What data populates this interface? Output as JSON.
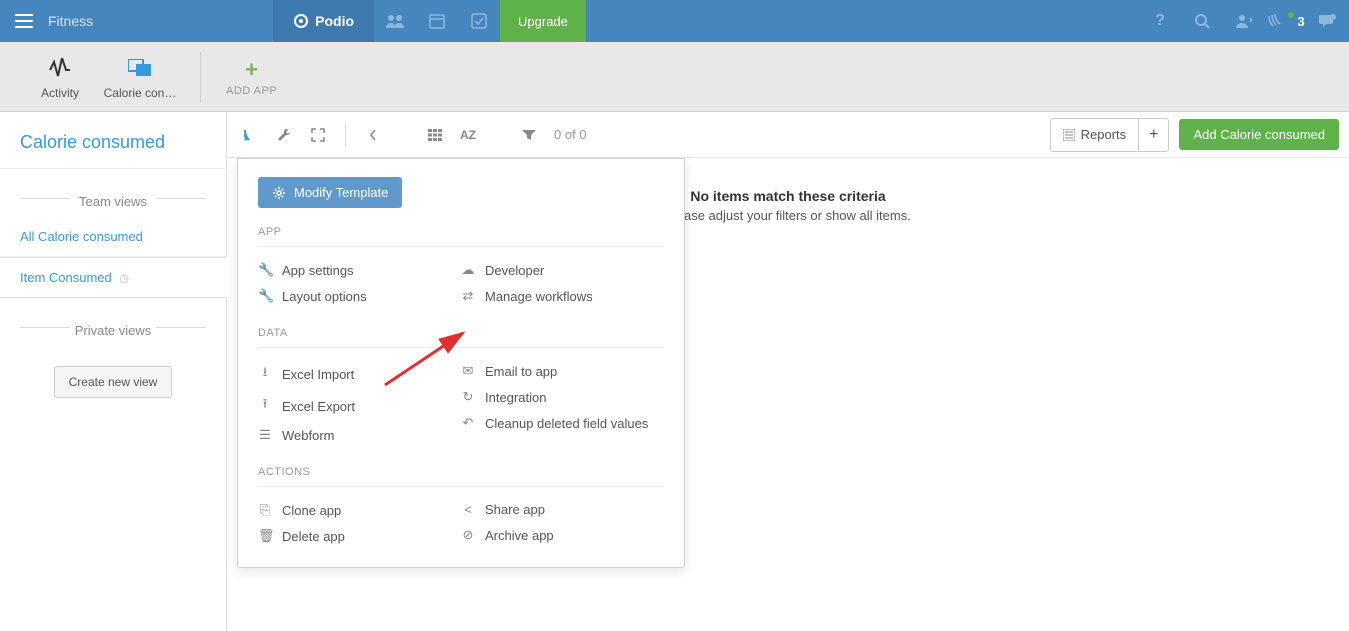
{
  "header": {
    "workspace": "Fitness",
    "brand": "Podio",
    "upgrade": "Upgrade",
    "notification_count": "3"
  },
  "appbar": {
    "activity": "Activity",
    "app_label": "Calorie con…",
    "add_app": "ADD APP"
  },
  "sidebar": {
    "title": "Calorie consumed",
    "team_views": "Team views",
    "private_views": "Private views",
    "items": [
      {
        "label": "All Calorie consumed"
      },
      {
        "label": "Item Consumed"
      }
    ],
    "create_view": "Create new view"
  },
  "toolbar": {
    "sort": "AZ",
    "count": "0 of 0",
    "reports": "Reports",
    "add_item": "Add Calorie consumed"
  },
  "dropdown": {
    "modify": "Modify Template",
    "sections": {
      "app": {
        "title": "APP",
        "left": [
          "App settings",
          "Layout options"
        ],
        "right": [
          "Developer",
          "Manage workflows"
        ]
      },
      "data": {
        "title": "DATA",
        "left": [
          "Excel Import",
          "Excel Export",
          "Webform"
        ],
        "right": [
          "Email to app",
          "Integration",
          "Cleanup deleted field values"
        ]
      },
      "actions": {
        "title": "ACTIONS",
        "left": [
          "Clone app",
          "Delete app"
        ],
        "right": [
          "Share app",
          "Archive app"
        ]
      }
    }
  },
  "empty": {
    "title": "No items match these criteria",
    "subtitle": "Please adjust your filters or show all items."
  }
}
